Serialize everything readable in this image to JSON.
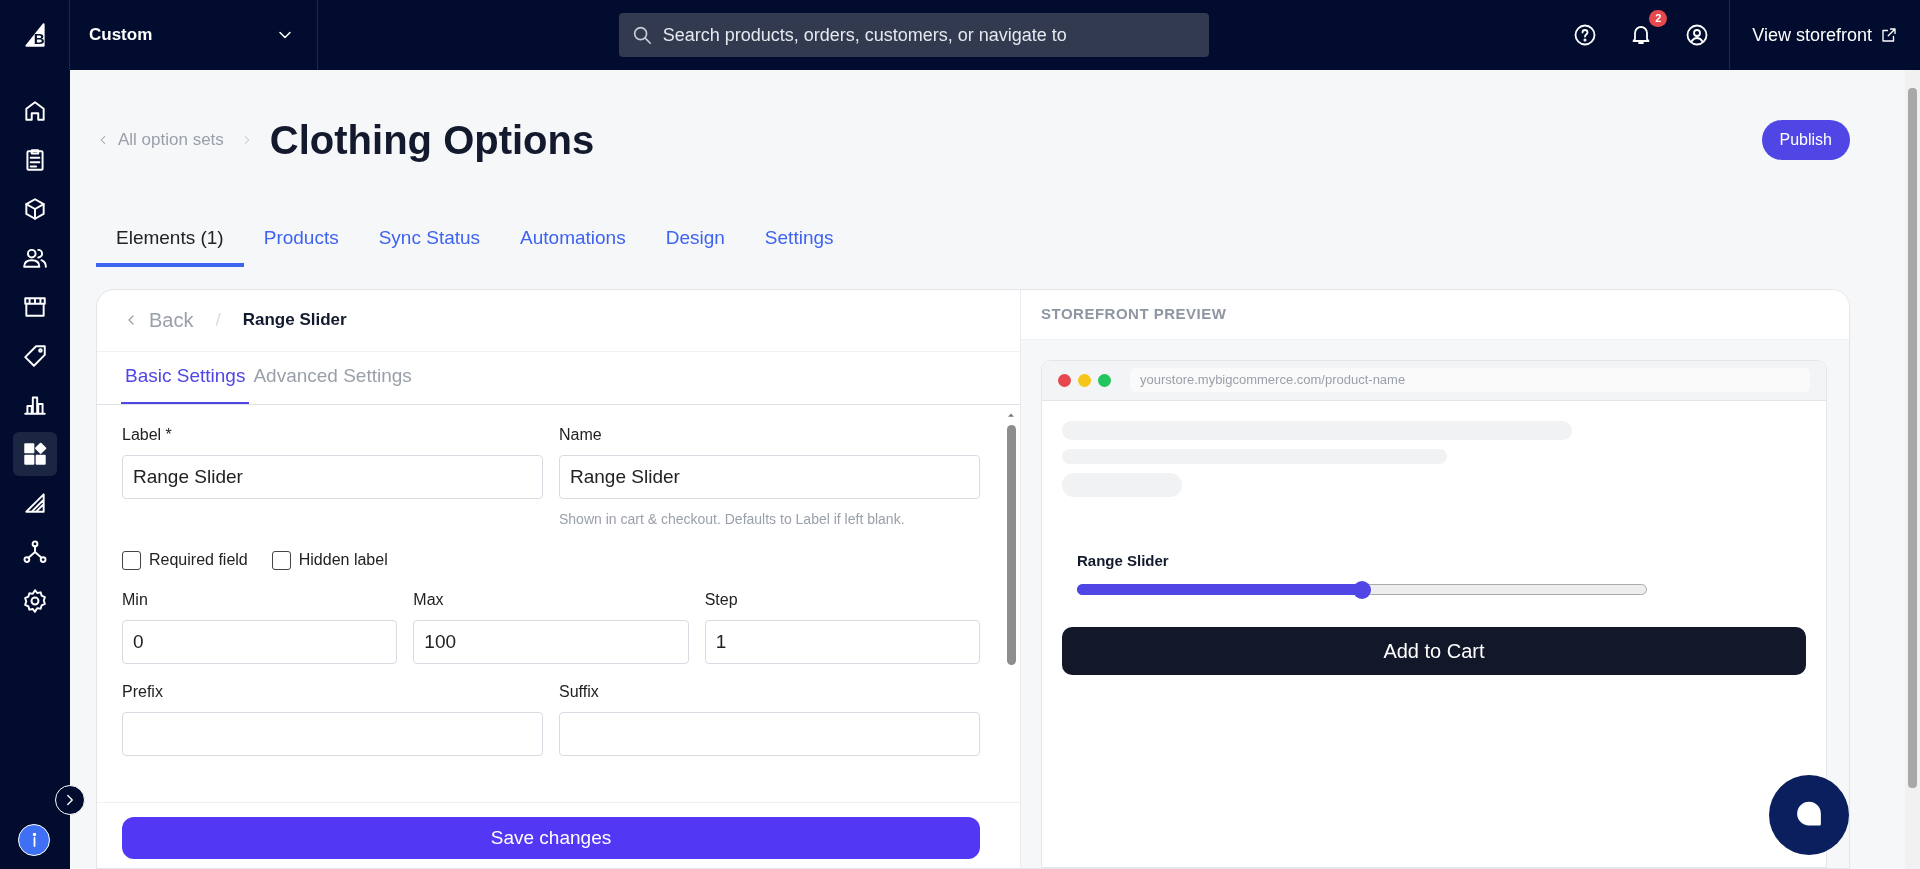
{
  "topbar": {
    "brand_mark": "B",
    "store_selector": "Custom",
    "search": {
      "placeholder": "Search products, orders, customers, or navigate to"
    },
    "notification_count": "2",
    "storefront_link": "View storefront"
  },
  "sidebar": {
    "items": [
      {
        "kind": "home",
        "selected": false
      },
      {
        "kind": "orders",
        "selected": false
      },
      {
        "kind": "products",
        "selected": false
      },
      {
        "kind": "customers",
        "selected": false
      },
      {
        "kind": "storefront",
        "selected": false
      },
      {
        "kind": "marketing",
        "selected": false
      },
      {
        "kind": "analytics",
        "selected": false
      },
      {
        "kind": "apps",
        "selected": true
      },
      {
        "kind": "channels",
        "selected": false
      },
      {
        "kind": "network",
        "selected": false
      },
      {
        "kind": "settings",
        "selected": false
      }
    ]
  },
  "header": {
    "breadcrumb": "All option sets",
    "title": "Clothing Options",
    "publish_button": "Publish"
  },
  "tabs": [
    {
      "label": "Elements (1)",
      "selected": true
    },
    {
      "label": "Products",
      "selected": false
    },
    {
      "label": "Sync Status",
      "selected": false
    },
    {
      "label": "Automations",
      "selected": false
    },
    {
      "label": "Design",
      "selected": false
    },
    {
      "label": "Settings",
      "selected": false
    }
  ],
  "editor": {
    "back": "Back",
    "separator": "/",
    "current": "Range Slider",
    "tabs": [
      {
        "label": "Basic Settings",
        "selected": true
      },
      {
        "label": "Advanced Settings",
        "selected": false
      }
    ],
    "row_1": [
      {
        "label": "Label *",
        "value": "Range Slider"
      },
      {
        "label": "Name",
        "value": "Range Slider",
        "help": "Shown in cart & checkout. Defaults to Label if left blank."
      }
    ],
    "checkboxes": [
      {
        "label": "Required field",
        "checked": false
      },
      {
        "label": "Hidden label",
        "checked": false
      }
    ],
    "row_2": [
      {
        "label": "Min",
        "value": "0"
      },
      {
        "label": "Max",
        "value": "100"
      },
      {
        "label": "Step",
        "value": "1"
      }
    ],
    "row_3": [
      {
        "label": "Prefix"
      },
      {
        "label": "Suffix"
      }
    ],
    "save_button": "Save changes"
  },
  "preview": {
    "heading": "STOREFRONT PREVIEW",
    "url": "yourstore.mybigcommerce.com/product-name",
    "slider": {
      "label": "Range Slider",
      "level": 0.5
    },
    "cart_button": "Add to Cart"
  }
}
